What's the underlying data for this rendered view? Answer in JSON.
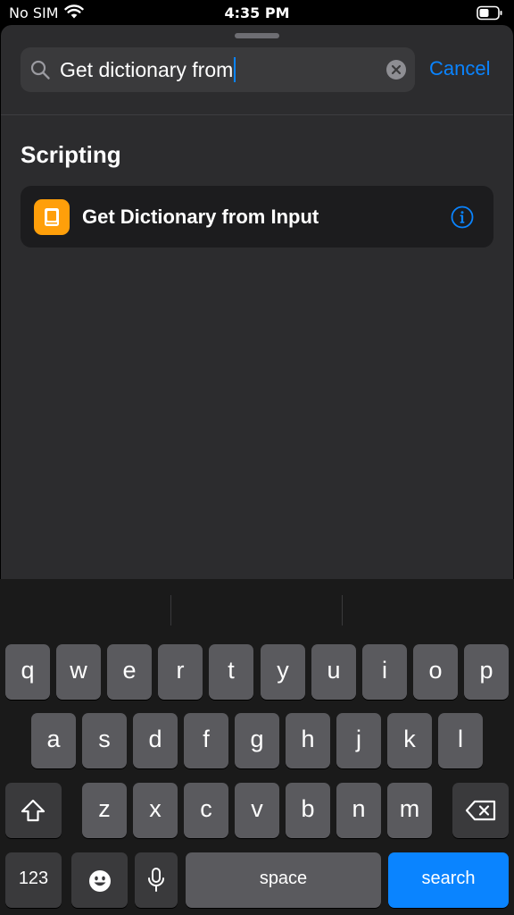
{
  "status_bar": {
    "carrier": "No SIM",
    "time": "4:35 PM"
  },
  "search": {
    "query": "Get dictionary from",
    "cancel_label": "Cancel"
  },
  "results": {
    "section_title": "Scripting",
    "items": [
      {
        "label": "Get Dictionary from Input",
        "icon": "scripting-dictionary-icon",
        "icon_color": "#ff9f0a"
      }
    ]
  },
  "keyboard": {
    "row1": [
      "q",
      "w",
      "e",
      "r",
      "t",
      "y",
      "u",
      "i",
      "o",
      "p"
    ],
    "row2": [
      "a",
      "s",
      "d",
      "f",
      "g",
      "h",
      "j",
      "k",
      "l"
    ],
    "row3": [
      "z",
      "x",
      "c",
      "v",
      "b",
      "n",
      "m"
    ],
    "numbers_label": "123",
    "space_label": "space",
    "search_label": "search"
  },
  "colors": {
    "accent": "#0a84ff",
    "sheet_background": "#2c2c2e",
    "row_background": "#1c1c1e"
  }
}
